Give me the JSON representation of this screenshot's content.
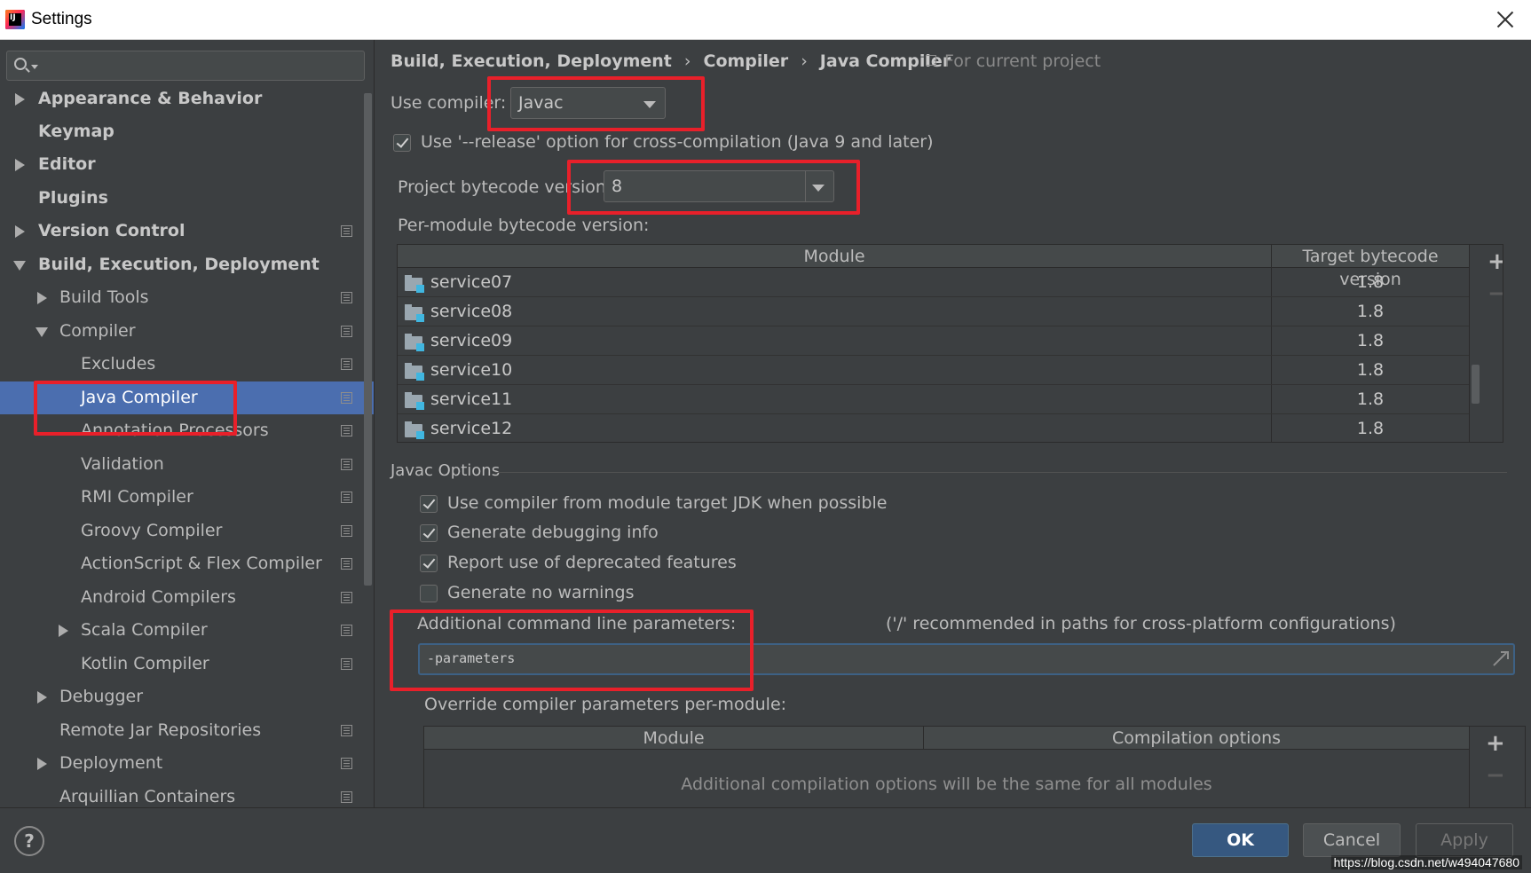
{
  "window": {
    "title": "Settings"
  },
  "sidebar": {
    "search_placeholder": "",
    "items": [
      {
        "label": "Appearance & Behavior"
      },
      {
        "label": "Keymap"
      },
      {
        "label": "Editor"
      },
      {
        "label": "Plugins"
      },
      {
        "label": "Version Control"
      },
      {
        "label": "Build, Execution, Deployment"
      },
      {
        "label": "Build Tools"
      },
      {
        "label": "Compiler"
      },
      {
        "label": "Excludes"
      },
      {
        "label": "Java Compiler"
      },
      {
        "label": "Annotation Processors"
      },
      {
        "label": "Validation"
      },
      {
        "label": "RMI Compiler"
      },
      {
        "label": "Groovy Compiler"
      },
      {
        "label": "ActionScript & Flex Compiler"
      },
      {
        "label": "Android Compilers"
      },
      {
        "label": "Scala Compiler"
      },
      {
        "label": "Kotlin Compiler"
      },
      {
        "label": "Debugger"
      },
      {
        "label": "Remote Jar Repositories"
      },
      {
        "label": "Deployment"
      },
      {
        "label": "Arquillian Containers"
      }
    ]
  },
  "breadcrumb": {
    "parts": [
      "Build, Execution, Deployment",
      "Compiler",
      "Java Compiler"
    ],
    "separator": "›",
    "scope": "For current project"
  },
  "compiler": {
    "use_compiler_label": "Use compiler:",
    "use_compiler_value": "Javac",
    "release_option_label": "Use '--release' option for cross-compilation (Java 9 and later)",
    "release_option_checked": true,
    "bytecode_label": "Project bytecode version:",
    "bytecode_value": "8",
    "per_module_label": "Per-module bytecode version:"
  },
  "module_table": {
    "headers": [
      "Module",
      "Target bytecode version"
    ],
    "rows": [
      {
        "module": "service07",
        "version": "1.8"
      },
      {
        "module": "service08",
        "version": "1.8"
      },
      {
        "module": "service09",
        "version": "1.8"
      },
      {
        "module": "service10",
        "version": "1.8"
      },
      {
        "module": "service11",
        "version": "1.8"
      },
      {
        "module": "service12",
        "version": "1.8"
      }
    ],
    "add_symbol": "+",
    "remove_symbol": "−"
  },
  "javac_options": {
    "title": "Javac Options",
    "options": [
      {
        "label": "Use compiler from module target JDK when possible",
        "checked": true
      },
      {
        "label": "Generate debugging info",
        "checked": true
      },
      {
        "label": "Report use of deprecated features",
        "checked": true
      },
      {
        "label": "Generate no warnings",
        "checked": false
      }
    ],
    "additional_params_label": "Additional command line parameters:",
    "additional_params_hint": "('/' recommended in paths for cross-platform configurations)",
    "additional_params_value": "-parameters",
    "override_label": "Override compiler parameters per-module:"
  },
  "override_table": {
    "headers": [
      "Module",
      "Compilation options"
    ],
    "empty_text": "Additional compilation options will be the same for all modules",
    "add_symbol": "+",
    "remove_symbol": "−"
  },
  "footer": {
    "help": "?",
    "ok": "OK",
    "cancel": "Cancel",
    "apply": "Apply",
    "watermark": "https://blog.csdn.net/w494047680"
  },
  "colors": {
    "background": "#3c3f41",
    "selection": "#4b6eaf",
    "annotation": "#e8202a",
    "ok_button": "#365880"
  }
}
